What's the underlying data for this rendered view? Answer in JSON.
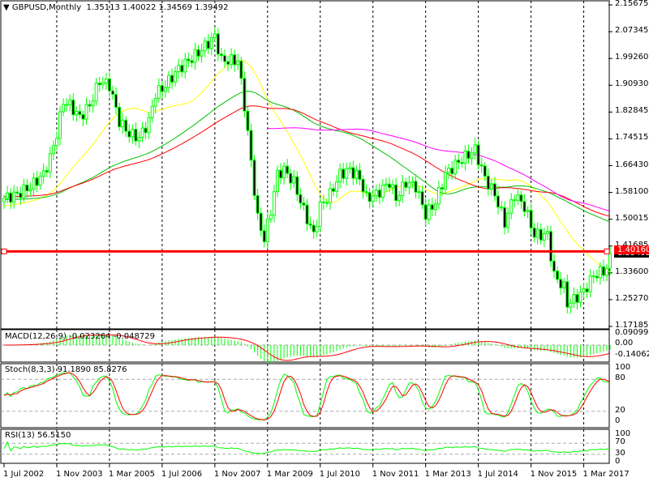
{
  "header": {
    "symbol_timeframe": "GBPUSD,Monthly",
    "ohlc": "1.35113 1.40022 1.34569 1.39492"
  },
  "price_axis": {
    "ticks": [
      "2.15675",
      "2.07345",
      "1.99260",
      "1.90930",
      "1.82845",
      "1.74515",
      "1.66430",
      "1.58100",
      "1.50015",
      "1.41685",
      "1.33600",
      "1.25270",
      "1.17185"
    ],
    "range": [
      1.17185,
      2.15675
    ]
  },
  "horizontal_line": {
    "value": 1.4016,
    "label": "1.40160",
    "color": "#ff0000"
  },
  "current_price_label": "1.39492",
  "macd": {
    "label": "MACD(12,26,9) -0.023264 -0.048729",
    "ticks": [
      "0.090995",
      "0.00",
      "-0.140628"
    ]
  },
  "stoch": {
    "label": "Stoch(8,3,3) 91.1890 85.8276",
    "ticks": [
      "100",
      "80",
      "20",
      "0"
    ]
  },
  "rsi": {
    "label": "RSI(13) 56.5150",
    "ticks": [
      "100",
      "70",
      "30",
      "0"
    ]
  },
  "time_axis": {
    "ticks": [
      "1 Jul 2002",
      "1 Nov 2003",
      "1 Mar 2005",
      "1 Jul 2006",
      "1 Nov 2007",
      "1 Mar 2009",
      "1 Jul 2010",
      "1 Nov 2011",
      "1 Mar 2013",
      "1 Jul 2014",
      "1 Nov 2015",
      "1 Mar 2017"
    ]
  },
  "colors": {
    "bull": "#00ff00",
    "bear": "#00ff00",
    "ma_fast": "#ffff00",
    "ma_mid": "#00c000",
    "ma_slow": "#ff0000",
    "ma_long": "#ff00ff",
    "signal": "#ff0000"
  },
  "chart_data": {
    "type": "candlestick",
    "title": "GBPUSD,Monthly",
    "start": "2002-07",
    "end": "2017-11",
    "ylim": [
      1.17185,
      2.15675
    ],
    "close_keypoints": [
      [
        "2002-07",
        1.564
      ],
      [
        "2002-11",
        1.576
      ],
      [
        "2003-03",
        1.6
      ],
      [
        "2003-07",
        1.638
      ],
      [
        "2003-09",
        1.688
      ],
      [
        "2003-11",
        1.762
      ],
      [
        "2004-01",
        1.861
      ],
      [
        "2004-03",
        1.849
      ],
      [
        "2004-06",
        1.812
      ],
      [
        "2004-09",
        1.849
      ],
      [
        "2004-12",
        1.924
      ],
      [
        "2005-03",
        1.911
      ],
      [
        "2005-06",
        1.8
      ],
      [
        "2005-09",
        1.762
      ],
      [
        "2005-12",
        1.75
      ],
      [
        "2006-03",
        1.8
      ],
      [
        "2006-05",
        1.886
      ],
      [
        "2006-07",
        1.899
      ],
      [
        "2006-10",
        1.936
      ],
      [
        "2006-12",
        1.961
      ],
      [
        "2007-06",
        2.01
      ],
      [
        "2007-11",
        2.06
      ],
      [
        "2008-01",
        1.986
      ],
      [
        "2008-06",
        1.986
      ],
      [
        "2008-08",
        1.849
      ],
      [
        "2008-10",
        1.676
      ],
      [
        "2008-12",
        1.502
      ],
      [
        "2009-02",
        1.44
      ],
      [
        "2009-04",
        1.527
      ],
      [
        "2009-06",
        1.638
      ],
      [
        "2009-08",
        1.651
      ],
      [
        "2009-11",
        1.613
      ],
      [
        "2010-02",
        1.527
      ],
      [
        "2010-05",
        1.452
      ],
      [
        "2010-07",
        1.539
      ],
      [
        "2010-10",
        1.576
      ],
      [
        "2011-01",
        1.638
      ],
      [
        "2011-04",
        1.651
      ],
      [
        "2011-07",
        1.626
      ],
      [
        "2011-09",
        1.564
      ],
      [
        "2011-12",
        1.576
      ],
      [
        "2012-04",
        1.613
      ],
      [
        "2012-06",
        1.564
      ],
      [
        "2012-09",
        1.613
      ],
      [
        "2012-12",
        1.601
      ],
      [
        "2013-03",
        1.514
      ],
      [
        "2013-06",
        1.552
      ],
      [
        "2013-09",
        1.638
      ],
      [
        "2014-01",
        1.676
      ],
      [
        "2014-06",
        1.713
      ],
      [
        "2014-09",
        1.626
      ],
      [
        "2014-12",
        1.576
      ],
      [
        "2015-03",
        1.489
      ],
      [
        "2015-06",
        1.576
      ],
      [
        "2015-09",
        1.539
      ],
      [
        "2015-12",
        1.452
      ],
      [
        "2016-04",
        1.452
      ],
      [
        "2016-06",
        1.328
      ],
      [
        "2016-09",
        1.291
      ],
      [
        "2016-10",
        1.241
      ],
      [
        "2016-12",
        1.254
      ],
      [
        "2017-03",
        1.279
      ],
      [
        "2017-06",
        1.328
      ],
      [
        "2017-09",
        1.341
      ],
      [
        "2017-10",
        1.351
      ],
      [
        "2017-11",
        1.39492
      ]
    ]
  }
}
